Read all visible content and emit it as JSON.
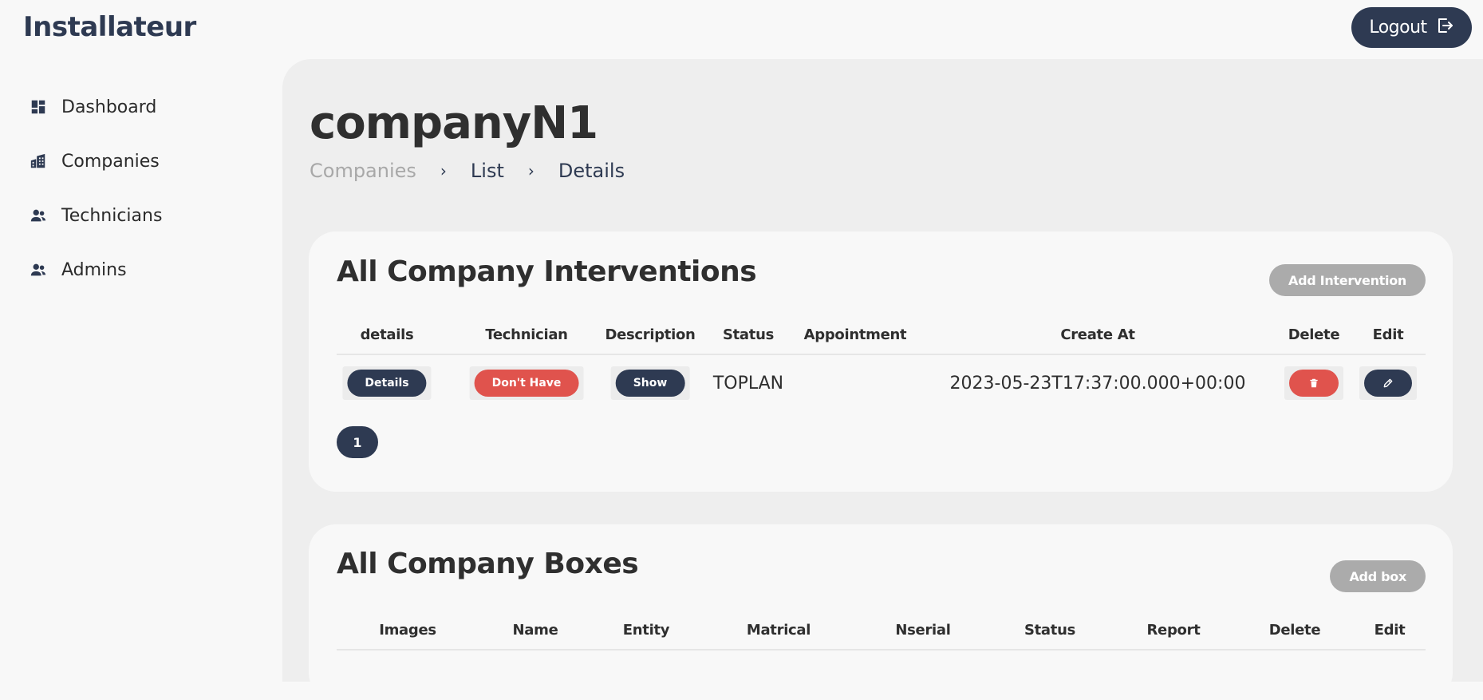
{
  "app": {
    "title": "Installateur"
  },
  "header": {
    "logout_label": "Logout"
  },
  "sidebar": {
    "items": [
      {
        "label": "Dashboard",
        "icon": "dashboard-icon"
      },
      {
        "label": "Companies",
        "icon": "building-icon"
      },
      {
        "label": "Technicians",
        "icon": "users-icon"
      },
      {
        "label": "Admins",
        "icon": "users-icon"
      }
    ]
  },
  "page": {
    "title": "companyN1",
    "breadcrumb": [
      "Companies",
      "List",
      "Details"
    ]
  },
  "interventions": {
    "title": "All Company Interventions",
    "add_label": "Add Intervention",
    "columns": [
      "details",
      "Technician",
      "Description",
      "Status",
      "Appointment",
      "Create At",
      "Delete",
      "Edit"
    ],
    "rows": [
      {
        "details_label": "Details",
        "technician_label": "Don't Have",
        "description_label": "Show",
        "status": "TOPLAN",
        "appointment": "",
        "created_at": "2023-05-23T17:37:00.000+00:00"
      }
    ],
    "pagination": {
      "current_page": "1"
    }
  },
  "boxes": {
    "title": "All Company Boxes",
    "add_label": "Add box",
    "columns": [
      "Images",
      "Name",
      "Entity",
      "Matrical",
      "Nserial",
      "Status",
      "Report",
      "Delete",
      "Edit"
    ]
  },
  "colors": {
    "primary": "#2e3a52",
    "danger": "#e0534d",
    "muted_button": "#ababab",
    "content_bg": "#eeeeee"
  }
}
